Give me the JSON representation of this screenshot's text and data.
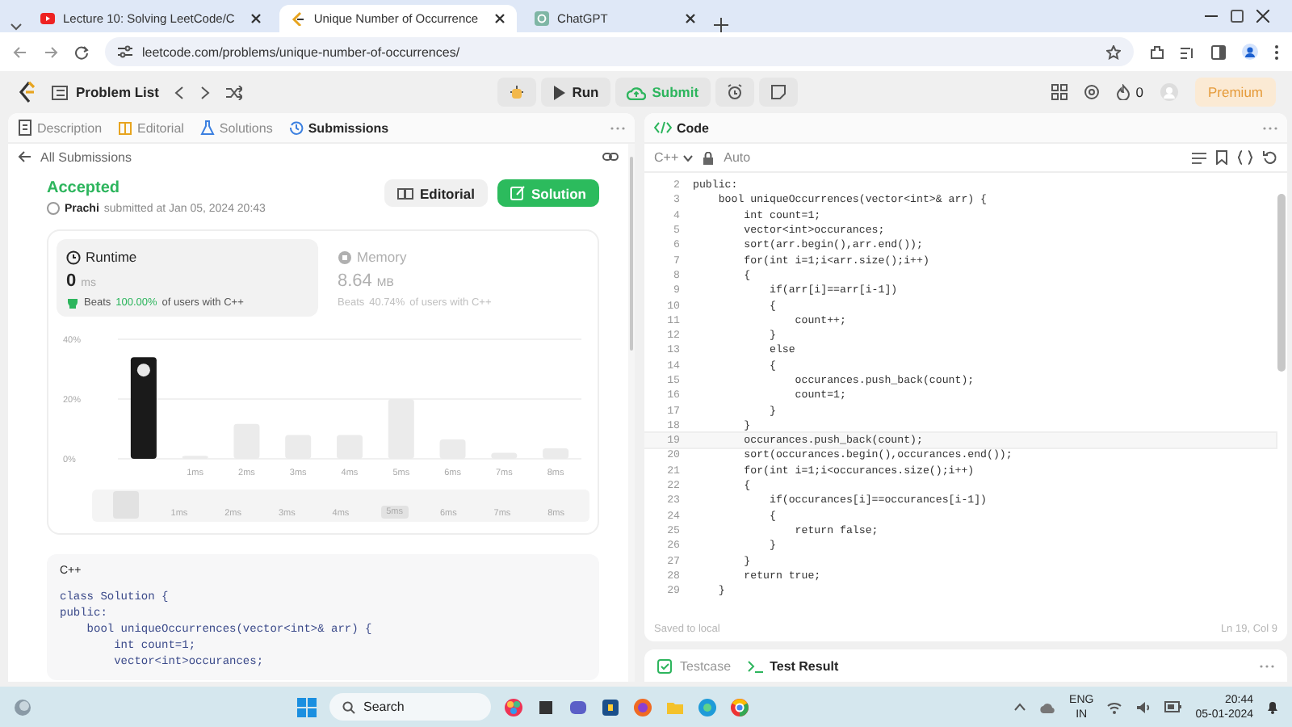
{
  "browser": {
    "tabs": [
      {
        "title": "Lecture 10: Solving LeetCode/C",
        "kind": "video",
        "selected": false
      },
      {
        "title": "Unique Number of Occurrence",
        "kind": "leetcode",
        "selected": true
      },
      {
        "title": "ChatGPT",
        "kind": "chat",
        "selected": false
      }
    ],
    "url": "leetcode.com/problems/unique-number-of-occurrences/"
  },
  "header": {
    "problem_list": "Problem List",
    "run": "Run",
    "submit": "Submit",
    "streak": "0",
    "premium": "Premium"
  },
  "left": {
    "tabs": [
      {
        "label": "Description",
        "kind": "doc",
        "selected": false
      },
      {
        "label": "Editorial",
        "kind": "book",
        "selected": false
      },
      {
        "label": "Solutions",
        "kind": "flask",
        "selected": false
      },
      {
        "label": "Submissions",
        "kind": "history",
        "selected": true
      }
    ],
    "back": "All Submissions",
    "status": "Accepted",
    "user": "Prachi",
    "submitted": "submitted at Jan 05, 2024 20:43",
    "editorial_button": "Editorial",
    "solution_button": "Solution",
    "stats": [
      {
        "label": "Runtime",
        "kind": "clock",
        "value": "0",
        "unit": "ms",
        "beats_label": "Beats",
        "beats": "100.00%",
        "beats_suffix": "of users with C++",
        "selected": true
      },
      {
        "label": "Memory",
        "kind": "chip",
        "value": "8.64",
        "unit": "MB",
        "beats_label": "Beats",
        "beats": "40.74%",
        "beats_suffix": "of users with C++",
        "selected": false
      }
    ],
    "chart_data": {
      "type": "bar",
      "categories": [
        null,
        "1ms",
        "2ms",
        "3ms",
        "4ms",
        "5ms",
        "6ms",
        "7ms",
        "8ms"
      ],
      "series": [
        {
          "color": "#1a1a1a",
          "values": [
            34,
            null,
            null,
            null,
            null,
            null,
            null,
            null,
            null
          ]
        },
        {
          "color": "#ebebeb",
          "values": [
            null,
            1,
            11.7,
            8,
            8,
            20,
            6.5,
            2,
            3.5
          ]
        }
      ],
      "ylim": [
        0,
        40
      ],
      "yticks": [
        {
          "value": 0,
          "label": "0%"
        },
        {
          "value": 20,
          "label": "20%"
        },
        {
          "value": 40,
          "label": "40%"
        }
      ]
    },
    "overview_labels": [
      "1ms",
      "2ms",
      "3ms",
      "4ms",
      "5ms",
      "6ms",
      "7ms",
      "8ms"
    ],
    "code_preview": {
      "language": "C++",
      "lines": [
        "class Solution {",
        "public:",
        "    bool uniqueOccurrences(vector<int>& arr) {",
        "        int count=1;",
        "        vector<int>occurances;"
      ]
    }
  },
  "editor": {
    "title": "Code",
    "language": "C++",
    "mode": "Auto",
    "lines": [
      {
        "n": "2",
        "text": "public:",
        "selected": false
      },
      {
        "n": "3",
        "text": "    bool uniqueOccurrences(vector<int>& arr) {",
        "selected": false
      },
      {
        "n": "4",
        "text": "        int count=1;",
        "selected": false
      },
      {
        "n": "5",
        "text": "        vector<int>occurances;",
        "selected": false
      },
      {
        "n": "6",
        "text": "        sort(arr.begin(),arr.end());",
        "selected": false
      },
      {
        "n": "7",
        "text": "        for(int i=1;i<arr.size();i++)",
        "selected": false
      },
      {
        "n": "8",
        "text": "        {",
        "selected": false
      },
      {
        "n": "9",
        "text": "            if(arr[i]==arr[i-1])",
        "selected": false
      },
      {
        "n": "10",
        "text": "            {",
        "selected": false
      },
      {
        "n": "11",
        "text": "                count++;",
        "selected": false
      },
      {
        "n": "12",
        "text": "            }",
        "selected": false
      },
      {
        "n": "13",
        "text": "            else",
        "selected": false
      },
      {
        "n": "14",
        "text": "            {",
        "selected": false
      },
      {
        "n": "15",
        "text": "                occurances.push_back(count);",
        "selected": false
      },
      {
        "n": "16",
        "text": "                count=1;",
        "selected": false
      },
      {
        "n": "17",
        "text": "            }",
        "selected": false
      },
      {
        "n": "18",
        "text": "        }",
        "selected": false
      },
      {
        "n": "19",
        "text": "        occurances.push_back(count);",
        "selected": true
      },
      {
        "n": "20",
        "text": "        sort(occurances.begin(),occurances.end());",
        "selected": false
      },
      {
        "n": "21",
        "text": "        for(int i=1;i<occurances.size();i++)",
        "selected": false
      },
      {
        "n": "22",
        "text": "        {",
        "selected": false
      },
      {
        "n": "23",
        "text": "            if(occurances[i]==occurances[i-1])",
        "selected": false
      },
      {
        "n": "24",
        "text": "            {",
        "selected": false
      },
      {
        "n": "25",
        "text": "                return false;",
        "selected": false
      },
      {
        "n": "26",
        "text": "            }",
        "selected": false
      },
      {
        "n": "27",
        "text": "        }",
        "selected": false
      },
      {
        "n": "28",
        "text": "        return true;",
        "selected": false
      },
      {
        "n": "29",
        "text": "    }",
        "selected": false
      }
    ],
    "saved": "Saved to local",
    "cursor": "Ln 19, Col 9"
  },
  "bottom_tabs": [
    {
      "label": "Testcase",
      "kind": "check",
      "selected": false
    },
    {
      "label": "Test Result",
      "kind": "terminal",
      "selected": true
    }
  ],
  "taskbar": {
    "search": "Search",
    "lang": "ENG",
    "region": "IN",
    "time": "20:44",
    "date": "05-01-2024"
  }
}
